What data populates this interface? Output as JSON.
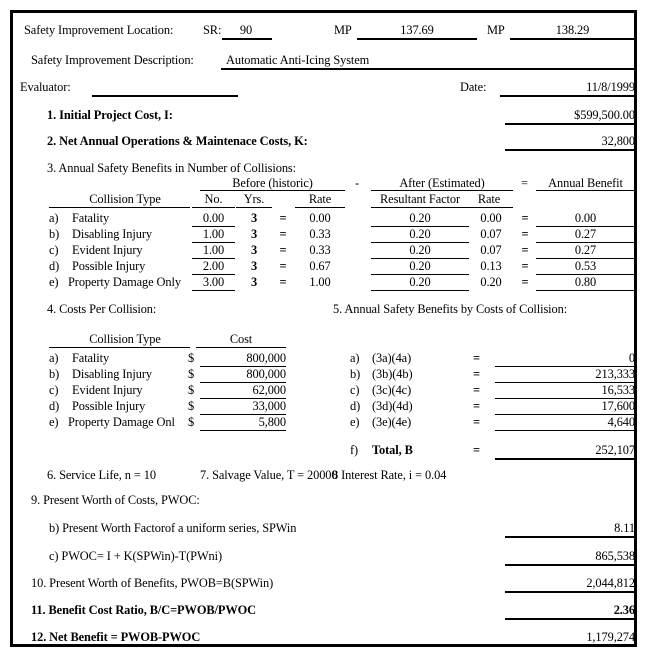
{
  "form": {
    "location_label": "Safety Improvement Location:",
    "sr_label": "SR:",
    "sr_value": "90",
    "mp1_label": "MP",
    "mp1_value": "137.69",
    "mp2_label": "MP",
    "mp2_value": "138.29",
    "description_label": "Safety Improvement Description:",
    "description_value": "Automatic Anti-Icing System",
    "evaluator_label": "Evaluator:",
    "evaluator_value": "",
    "date_label": "Date:",
    "date_value": "11/8/1999"
  },
  "item1": {
    "label": "1. Initial Project Cost, I:",
    "value": "$599,500.00"
  },
  "item2": {
    "label": "2. Net Annual Operations & Maintenace Costs, K:",
    "value": "32,800"
  },
  "item3": {
    "label": "3. Annual Safety Benefits in Number of Collisions:",
    "group_before": "Before (historic)",
    "minus_sign": "-",
    "group_after": "After (Estimated)",
    "equals_sign": "=",
    "group_benefit": "Annual Benefit",
    "col_type": "Collision Type",
    "col_no": "No.",
    "col_yrs": "Yrs.",
    "col_rate": "Rate",
    "col_resultant_factor": "Resultant Factor",
    "col_rate2": "Rate",
    "rows": [
      {
        "key": "a)",
        "type": "Fatality",
        "no": "0.00",
        "yrs": "3",
        "eq1": "=",
        "rate": "0.00",
        "factor": "0.20",
        "rate2": "0.00",
        "eq2": "=",
        "benefit": "0.00"
      },
      {
        "key": "b)",
        "type": "Disabling Injury",
        "no": "1.00",
        "yrs": "3",
        "eq1": "=",
        "rate": "0.33",
        "factor": "0.20",
        "rate2": "0.07",
        "eq2": "=",
        "benefit": "0.27"
      },
      {
        "key": "c)",
        "type": "Evident Injury",
        "no": "1.00",
        "yrs": "3",
        "eq1": "=",
        "rate": "0.33",
        "factor": "0.20",
        "rate2": "0.07",
        "eq2": "=",
        "benefit": "0.27"
      },
      {
        "key": "d)",
        "type": "Possible Injury",
        "no": "2.00",
        "yrs": "3",
        "eq1": "=",
        "rate": "0.67",
        "factor": "0.20",
        "rate2": "0.13",
        "eq2": "=",
        "benefit": "0.53"
      },
      {
        "key": "e)",
        "type": "Property Damage Only",
        "no": "3.00",
        "yrs": "3",
        "eq1": "=",
        "rate": "1.00",
        "factor": "0.20",
        "rate2": "0.20",
        "eq2": "=",
        "benefit": "0.80"
      }
    ]
  },
  "item4": {
    "label": "4. Costs Per Collision:",
    "col_type": "Collision Type",
    "col_cost": "Cost",
    "rows": [
      {
        "key": "a)",
        "type": "Fatality",
        "currency": "$",
        "cost": "800,000"
      },
      {
        "key": "b)",
        "type": "Disabling Injury",
        "currency": "$",
        "cost": "800,000"
      },
      {
        "key": "c)",
        "type": "Evident Injury",
        "currency": "$",
        "cost": "62,000"
      },
      {
        "key": "d)",
        "type": "Possible Injury",
        "currency": "$",
        "cost": "33,000"
      },
      {
        "key": "e)",
        "type": "Property Damage Onl",
        "currency": "$",
        "cost": "5,800"
      }
    ]
  },
  "item5": {
    "label": "5. Annual Safety Benefits by Costs of Collision:",
    "rows": [
      {
        "key": "a)",
        "formula": "(3a)(4a)",
        "eq": "=",
        "value": "0"
      },
      {
        "key": "b)",
        "formula": "(3b)(4b)",
        "eq": "=",
        "value": "213,333"
      },
      {
        "key": "c)",
        "formula": "(3c)(4c)",
        "eq": "=",
        "value": "16,533"
      },
      {
        "key": "d)",
        "formula": "(3d)(4d)",
        "eq": "=",
        "value": "17,600"
      },
      {
        "key": "e)",
        "formula": "(3e)(4e)",
        "eq": "=",
        "value": "4,640"
      }
    ],
    "total_key": "f)",
    "total_label": "Total, B",
    "total_eq": "=",
    "total_value": "252,107"
  },
  "item6": {
    "label": "6. Service Life, n = 10"
  },
  "item7": {
    "label": "7. Salvage Value, T = 20000"
  },
  "item8": {
    "label": "8 Interest Rate, i = 0.04"
  },
  "item9": {
    "label": "9. Present Worth of Costs, PWOC:",
    "b_label": "b)  Present Worth Factorof a uniform series, SPWin",
    "b_value": "8.11",
    "c_label": "c)  PWOC= I + K(SPWin)-T(PWni)",
    "c_value": "865,538"
  },
  "item10": {
    "label": "10. Present Worth of Benefits, PWOB=B(SPWin)",
    "value": "2,044,812"
  },
  "item11": {
    "label": "11. Benefit Cost Ratio, B/C=PWOB/PWOC",
    "value": "2.36"
  },
  "item12": {
    "label": "12. Net Benefit = PWOB-PWOC",
    "value": "1,179,274"
  }
}
